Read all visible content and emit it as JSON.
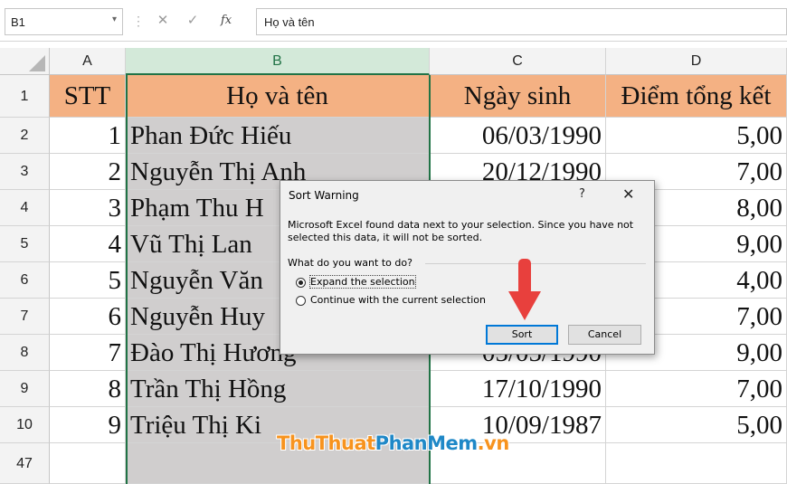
{
  "formula_bar": {
    "name_box": "B1",
    "cancel_icon": "✕",
    "enter_icon": "✓",
    "fx_label": "fx",
    "formula": "Họ và tên"
  },
  "columns": [
    "A",
    "B",
    "C",
    "D"
  ],
  "rows": [
    {
      "num": "1",
      "a": "STT",
      "b": "Họ và tên",
      "c": "Ngày sinh",
      "d": "Điểm tổng kết"
    },
    {
      "num": "2",
      "a": "1",
      "b": "Phan Đức Hiếu",
      "c": "06/03/1990",
      "d": "5,00"
    },
    {
      "num": "3",
      "a": "2",
      "b": "Nguyễn Thị Anh",
      "c": "20/12/1990",
      "d": "7,00"
    },
    {
      "num": "4",
      "a": "3",
      "b": "Phạm Thu H",
      "c": "",
      "d": "8,00"
    },
    {
      "num": "5",
      "a": "4",
      "b": "Vũ Thị Lan",
      "c": "",
      "d": "9,00"
    },
    {
      "num": "6",
      "a": "5",
      "b": "Nguyễn Văn",
      "c": "",
      "d": "4,00"
    },
    {
      "num": "7",
      "a": "6",
      "b": "Nguyễn Huy",
      "c": "",
      "d": "7,00"
    },
    {
      "num": "8",
      "a": "7",
      "b": "Đào Thị Hương",
      "c": "05/05/1990",
      "d": "9,00"
    },
    {
      "num": "9",
      "a": "8",
      "b": "Trần Thị Hồng",
      "c": "17/10/1990",
      "d": "7,00"
    },
    {
      "num": "10",
      "a": "9",
      "b": "Triệu Thị Ki",
      "c": "10/09/1987",
      "d": "5,00"
    },
    {
      "num": "47",
      "a": "",
      "b": "",
      "c": "",
      "d": ""
    }
  ],
  "dialog": {
    "title": "Sort Warning",
    "help": "?",
    "close": "✕",
    "message_line1": "Microsoft Excel found data next to your selection.  Since you have not",
    "message_line2": "selected this data, it will not be sorted.",
    "question": "What do you want to do?",
    "option_expand": "Expand the selection",
    "option_continue": "Continue with the current selection",
    "selected_option": "expand",
    "sort_button": "Sort",
    "cancel_button": "Cancel"
  },
  "colors": {
    "header_fill": "#f4b183",
    "selection_fill": "#d0cece",
    "selection_border": "#217346",
    "arrow": "#e8403d"
  },
  "watermark": {
    "part1": "ThuThuat",
    "part2": "PhanMem",
    "part3": ".vn"
  }
}
